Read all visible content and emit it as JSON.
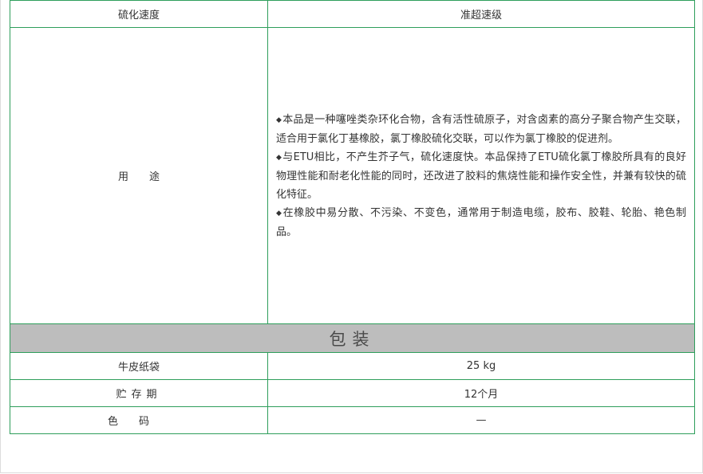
{
  "table": {
    "header": {
      "label": "硫化速度",
      "value": "准超速级"
    },
    "usage": {
      "label": "用　　途",
      "bullet": "◆",
      "paragraphs": [
        "本品是一种噻唑类杂环化合物，含有活性硫原子，对含卤素的高分子聚合物产生交联，适合用于氯化丁基橡胶，氯丁橡胶硫化交联，可以作为氯丁橡胶的促进剂。",
        "与ETU相比，不产生芥子气，硫化速度快。本品保持了ETU硫化氯丁橡胶所具有的良好物理性能和耐老化性能的同时，还改进了胶料的焦烧性能和操作安全性，并兼有较快的硫化特征。",
        "在橡胶中易分散、不污染、不变色，通常用于制造电缆，胶布、胶鞋、轮胎、艳色制品。"
      ]
    },
    "packaging_title": "包装",
    "rows": [
      {
        "label": "牛皮纸袋",
        "value": "25 kg"
      },
      {
        "label": "贮存期",
        "value": "12个月"
      },
      {
        "label": "色码",
        "value": "—"
      }
    ]
  },
  "colors": {
    "border": "#2e9e5b",
    "section_bg": "#bdbdbd"
  }
}
